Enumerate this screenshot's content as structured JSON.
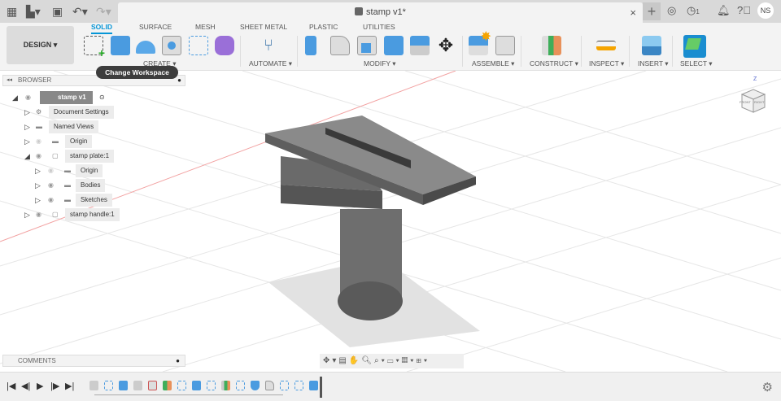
{
  "document": {
    "title": "stamp v1*"
  },
  "topbar": {
    "icons": [
      "apps-grid-icon",
      "file-icon",
      "save-icon",
      "undo-icon",
      "redo-icon"
    ],
    "jobs_count": "1",
    "user_initials": "NS"
  },
  "workspace": {
    "label": "DESIGN ▾",
    "tooltip": "Change Workspace"
  },
  "tabs": [
    {
      "label": "SOLID",
      "active": true
    },
    {
      "label": "SURFACE"
    },
    {
      "label": "MESH"
    },
    {
      "label": "SHEET METAL"
    },
    {
      "label": "PLASTIC"
    },
    {
      "label": "UTILITIES"
    }
  ],
  "groups": {
    "create": "CREATE ▾",
    "automate": "AUTOMATE ▾",
    "modify": "MODIFY ▾",
    "assemble": "ASSEMBLE ▾",
    "construct": "CONSTRUCT ▾",
    "inspect": "INSPECT ▾",
    "insert": "INSERT ▾",
    "select": "SELECT ▾"
  },
  "browser": {
    "title": "BROWSER",
    "items": [
      {
        "label": "stamp v1"
      },
      {
        "label": "Document Settings"
      },
      {
        "label": "Named Views"
      },
      {
        "label": "Origin"
      },
      {
        "label": "stamp plate:1"
      },
      {
        "label": "Origin"
      },
      {
        "label": "Bodies"
      },
      {
        "label": "Sketches"
      },
      {
        "label": "stamp handle:1"
      }
    ]
  },
  "comments": {
    "title": "COMMENTS"
  },
  "viewcube": {
    "front": "FRONT",
    "right": "RIGHT",
    "axis": "Z"
  },
  "colors": {
    "accent": "#0696d7",
    "tooltip": "#3d3d3d"
  }
}
